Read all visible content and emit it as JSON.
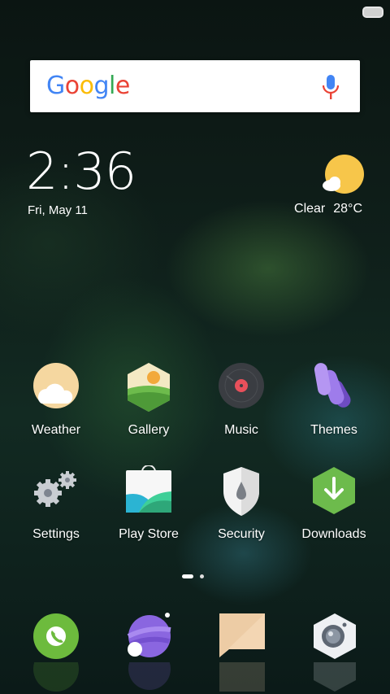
{
  "search": {
    "logo_text": "Google",
    "logo_colors": [
      "#4285F4",
      "#EA4335",
      "#FBBC05",
      "#4285F4",
      "#34A853",
      "#EA4335"
    ]
  },
  "clock": {
    "time": "2:36",
    "date": "Fri, May 11"
  },
  "weather": {
    "condition": "Clear",
    "temperature": "28°C"
  },
  "apps": [
    {
      "label": "Weather",
      "icon": "weather-icon"
    },
    {
      "label": "Gallery",
      "icon": "gallery-icon"
    },
    {
      "label": "Music",
      "icon": "music-icon"
    },
    {
      "label": "Themes",
      "icon": "themes-icon"
    },
    {
      "label": "Settings",
      "icon": "settings-icon"
    },
    {
      "label": "Play Store",
      "icon": "play-store-icon"
    },
    {
      "label": "Security",
      "icon": "security-icon"
    },
    {
      "label": "Downloads",
      "icon": "downloads-icon"
    }
  ],
  "dock": [
    {
      "icon": "phone-icon"
    },
    {
      "icon": "browser-icon"
    },
    {
      "icon": "messages-icon"
    },
    {
      "icon": "camera-icon"
    }
  ],
  "page_indicator": {
    "pages": 2,
    "active": 1
  }
}
